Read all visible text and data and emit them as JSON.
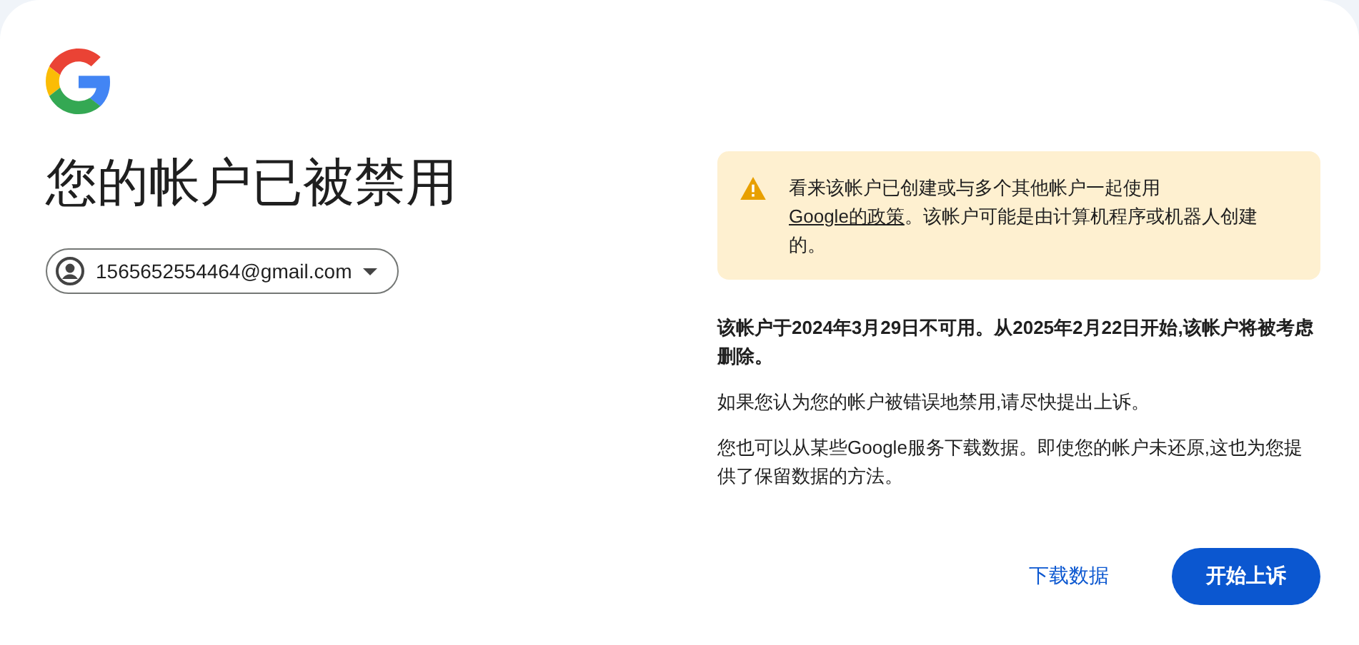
{
  "title": "您的帐户已被禁用",
  "account": {
    "email": "1565652554464@gmail.com"
  },
  "warning": {
    "text_before": "看来该帐户已创建或与多个其他帐户一起使用",
    "link": "Google的政策",
    "text_after": "。该帐户可能是由计算机程序或机器人创建的。"
  },
  "paragraphs": [
    {
      "text": "该帐户于2024年3月29日不可用。从2025年2月22日开始,该帐户将被考虑删除。",
      "kind": "bold"
    },
    {
      "text": "如果您认为您的帐户被错误地禁用,请尽快提出上诉。",
      "kind": "plain"
    },
    {
      "text": "您也可以从某些Google服务下载数据。即使您的帐户未还原,这也为您提供了保留数据的方法。",
      "kind": "plain"
    }
  ],
  "buttons": [
    {
      "label": "下载数据",
      "kind": "text"
    },
    {
      "label": "开始上诉",
      "kind": "filled"
    }
  ]
}
